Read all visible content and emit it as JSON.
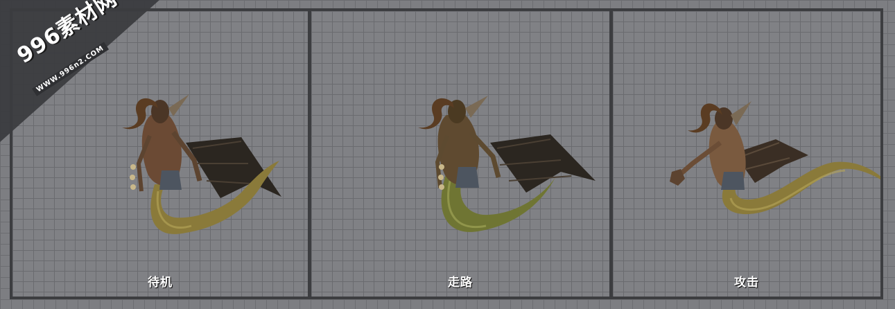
{
  "watermark": {
    "main_text": "996素材网",
    "sub_text": "WWW.996n2.COM"
  },
  "panels": [
    {
      "label": "待机"
    },
    {
      "label": "走路"
    },
    {
      "label": "攻击"
    }
  ],
  "colors": {
    "frame": "#3c3d40",
    "panel_bg": "#808185",
    "scale_gold": "#8a7a3a",
    "scale_green": "#6f7533",
    "wing": "#2b2620",
    "horn": "#5a3c22"
  }
}
